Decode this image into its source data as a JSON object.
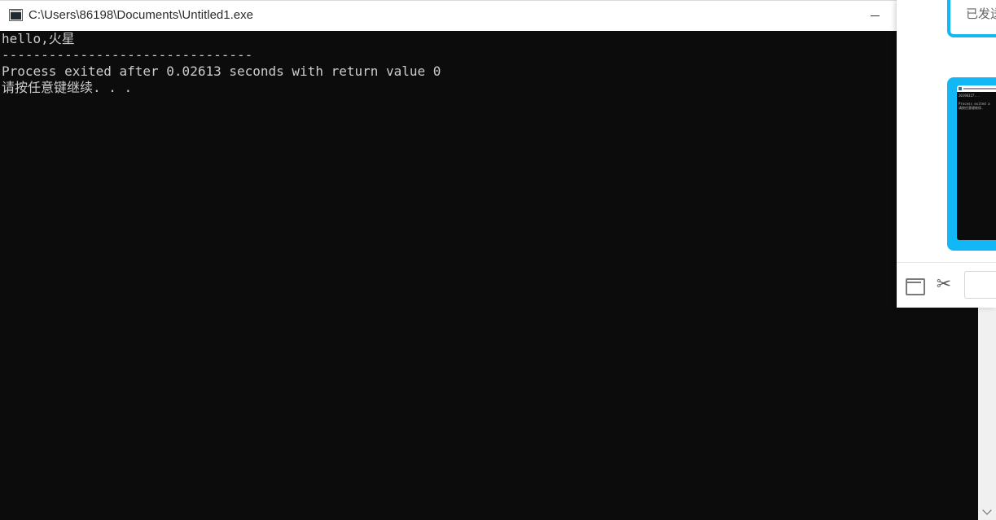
{
  "window": {
    "title": "C:\\Users\\86198\\Documents\\Untitled1.exe"
  },
  "console": {
    "lines": [
      "hello,火星",
      "--------------------------------",
      "Process exited after 0.02613 seconds with return value 0",
      "请按任意键继续. . ."
    ]
  },
  "chat": {
    "bubble_text": "已发送",
    "thumbnail": {
      "title": "C:\\Users\\86198\\Documents\\Untitled1.exe",
      "lines": [
        "20190327...",
        "",
        "Process exited a",
        "请按任意键继续."
      ]
    }
  },
  "icons": {
    "app": "console-app-icon",
    "minimize": "minimize-icon",
    "scroll_down": "chevron-down-icon",
    "folder": "folder-icon",
    "scissors": "scissors-icon"
  },
  "colors": {
    "console_bg": "#0c0c0c",
    "console_text": "#cccccc",
    "accent": "#12b7f5"
  }
}
